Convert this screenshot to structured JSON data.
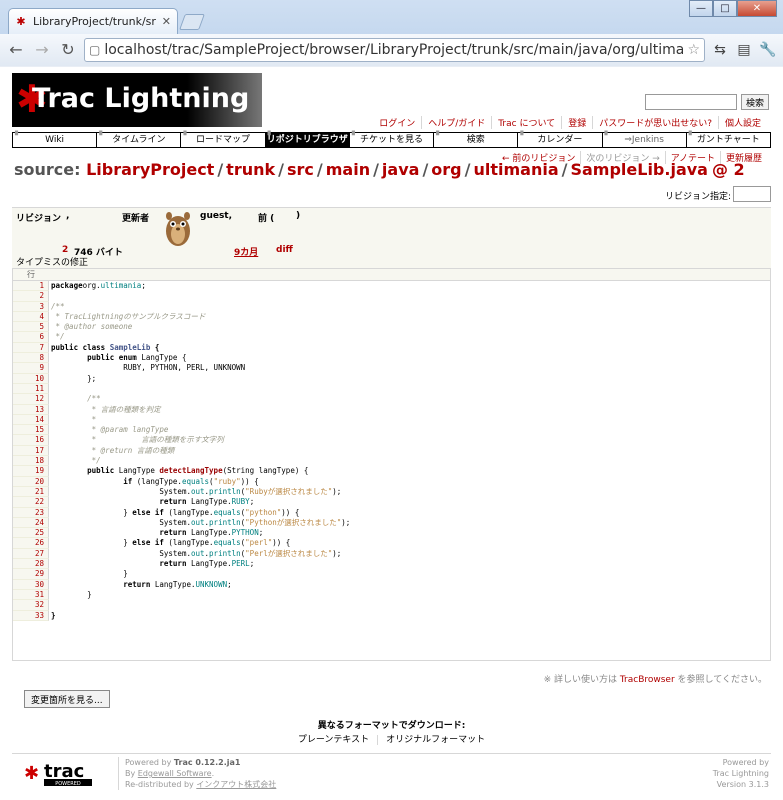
{
  "browser": {
    "tab_title": "LibraryProject/trunk/src...",
    "url": "localhost/trac/SampleProject/browser/LibraryProject/trunk/src/main/java/org/ultimania/SampleLib.java",
    "win_min": "—",
    "win_max": "□",
    "win_close": "✕"
  },
  "header": {
    "logo_text": "Trac Lightning",
    "search_button": "検索"
  },
  "metanav": [
    "ログイン",
    "ヘルプ/ガイド",
    "Trac について",
    "登録",
    "パスワードが思い出せない?",
    "個人設定"
  ],
  "mainnav": [
    {
      "label": "Wiki",
      "state": ""
    },
    {
      "label": "タイムライン",
      "state": ""
    },
    {
      "label": "ロードマップ",
      "state": ""
    },
    {
      "label": "リポジトリブラウザ",
      "state": "active"
    },
    {
      "label": "チケットを見る",
      "state": ""
    },
    {
      "label": "検索",
      "state": ""
    },
    {
      "label": "カレンダー",
      "state": ""
    },
    {
      "label": "⇒Jenkins",
      "state": "dim"
    },
    {
      "label": "ガントチャート",
      "state": ""
    }
  ],
  "ctxtnav": {
    "prev": "← 前のリビジョン",
    "next": "次のリビジョン →",
    "annotate": "アノテート",
    "log": "更新履歴"
  },
  "source": {
    "prefix": "source:",
    "path": [
      "LibraryProject",
      "trunk",
      "src",
      "main",
      "java",
      "org",
      "ultimania",
      "SampleLib.java"
    ],
    "rev": "@ 2"
  },
  "rev_select_label": "リビジョン指定:",
  "info": {
    "rev_h": "リビジョン",
    "size_h": ",",
    "author_h": "更新者",
    "author": "guest,",
    "age_h": "前 (",
    "paren_close": ")",
    "rev": "2",
    "size": "746 バイト",
    "age": "9カ月",
    "diff": "diff",
    "message": "タイプミスの修正"
  },
  "code_header": "行",
  "code_lines": [
    [
      [
        "kw",
        "package"
      ],
      [
        "",
        "org."
      ],
      [
        "at",
        "ultimania"
      ],
      [
        "",
        ";"
      ]
    ],
    [],
    [
      [
        "cm",
        "/**"
      ]
    ],
    [
      [
        "cm",
        " * TracLightningのサンプルクラスコード"
      ]
    ],
    [
      [
        "cm",
        " * @author someone"
      ]
    ],
    [
      [
        "cm",
        " */"
      ]
    ],
    [
      [
        "kw",
        "public class "
      ],
      [
        "ty",
        "SampleLib"
      ],
      [
        "kw",
        " {"
      ]
    ],
    [
      [
        "",
        "        "
      ],
      [
        "kw",
        "public enum "
      ],
      [
        "",
        "LangType {"
      ]
    ],
    [
      [
        "",
        "                RUBY, PYTHON, PERL, UNKNOWN"
      ]
    ],
    [
      [
        "",
        "        };"
      ]
    ],
    [],
    [
      [
        "",
        "        "
      ],
      [
        "cm",
        "/**"
      ]
    ],
    [
      [
        "",
        "        "
      ],
      [
        "cm",
        " * 言語の種類を判定"
      ]
    ],
    [
      [
        "",
        "        "
      ],
      [
        "cm",
        " *"
      ]
    ],
    [
      [
        "",
        "        "
      ],
      [
        "cm",
        " * @param langType"
      ]
    ],
    [
      [
        "",
        "        "
      ],
      [
        "cm",
        " *          言語の種類を示す文字列"
      ]
    ],
    [
      [
        "",
        "        "
      ],
      [
        "cm",
        " * @return 言語の種類"
      ]
    ],
    [
      [
        "",
        "        "
      ],
      [
        "cm",
        " */"
      ]
    ],
    [
      [
        "",
        "        "
      ],
      [
        "kw",
        "public "
      ],
      [
        "",
        "LangType "
      ],
      [
        "fn",
        "detectLangType"
      ],
      [
        "",
        "(String langType) {"
      ]
    ],
    [
      [
        "",
        "                "
      ],
      [
        "kw",
        "if "
      ],
      [
        "",
        "(langType."
      ],
      [
        "at",
        "equals"
      ],
      [
        "",
        "("
      ],
      [
        "st",
        "\"ruby\""
      ],
      [
        "",
        ")) {"
      ]
    ],
    [
      [
        "",
        "                        System."
      ],
      [
        "at",
        "out"
      ],
      [
        "",
        "."
      ],
      [
        "at",
        "println"
      ],
      [
        "",
        "("
      ],
      [
        "st",
        "\"Rubyが選択されました\""
      ],
      [
        "",
        ");"
      ]
    ],
    [
      [
        "",
        "                        "
      ],
      [
        "kw",
        "return "
      ],
      [
        "",
        "LangType."
      ],
      [
        "at",
        "RUBY"
      ],
      [
        "",
        ";"
      ]
    ],
    [
      [
        "",
        "                } "
      ],
      [
        "kw",
        "else if "
      ],
      [
        "",
        "(langType."
      ],
      [
        "at",
        "equals"
      ],
      [
        "",
        "("
      ],
      [
        "st",
        "\"python\""
      ],
      [
        "",
        ")) {"
      ]
    ],
    [
      [
        "",
        "                        System."
      ],
      [
        "at",
        "out"
      ],
      [
        "",
        "."
      ],
      [
        "at",
        "println"
      ],
      [
        "",
        "("
      ],
      [
        "st",
        "\"Pythonが選択されました\""
      ],
      [
        "",
        ");"
      ]
    ],
    [
      [
        "",
        "                        "
      ],
      [
        "kw",
        "return "
      ],
      [
        "",
        "LangType."
      ],
      [
        "at",
        "PYTHON"
      ],
      [
        "",
        ";"
      ]
    ],
    [
      [
        "",
        "                } "
      ],
      [
        "kw",
        "else if "
      ],
      [
        "",
        "(langType."
      ],
      [
        "at",
        "equals"
      ],
      [
        "",
        "("
      ],
      [
        "st",
        "\"perl\""
      ],
      [
        "",
        ")) {"
      ]
    ],
    [
      [
        "",
        "                        System."
      ],
      [
        "at",
        "out"
      ],
      [
        "",
        "."
      ],
      [
        "at",
        "println"
      ],
      [
        "",
        "("
      ],
      [
        "st",
        "\"Perlが選択されました\""
      ],
      [
        "",
        ");"
      ]
    ],
    [
      [
        "",
        "                        "
      ],
      [
        "kw",
        "return "
      ],
      [
        "",
        "LangType."
      ],
      [
        "at",
        "PERL"
      ],
      [
        "",
        ";"
      ]
    ],
    [
      [
        "",
        "                }"
      ]
    ],
    [
      [
        "",
        "                "
      ],
      [
        "kw",
        "return "
      ],
      [
        "",
        "LangType."
      ],
      [
        "at",
        "UNKNOWN"
      ],
      [
        "",
        ";"
      ]
    ],
    [
      [
        "",
        "        }"
      ]
    ],
    [],
    [
      [
        "kw",
        "}"
      ]
    ]
  ],
  "tip": {
    "pre": "※ 詳しい使い方は ",
    "link": "TracBrowser",
    "post": " を参照してください。"
  },
  "diff_button": "変更箇所を見る...",
  "alt_formats": {
    "heading": "異なるフォーマットでダウンロード:",
    "links": [
      "プレーンテキスト",
      "オリジナルフォーマット"
    ]
  },
  "footer": {
    "powered_by": "Powered by ",
    "trac_version": "Trac 0.12.2.ja1",
    "by": "By ",
    "edgewall": "Edgewall Software",
    "period": ".",
    "redistributed": "Re-distributed by ",
    "redistributor": "インクアウト株式会社",
    "right_1": "Powered by",
    "right_2": "Trac Lightning",
    "right_3": "Version 3.1.3",
    "logo_text": "trac",
    "logo_sub": "POWERED"
  },
  "colors": {
    "link": "#b00000",
    "accent": "#000000"
  }
}
